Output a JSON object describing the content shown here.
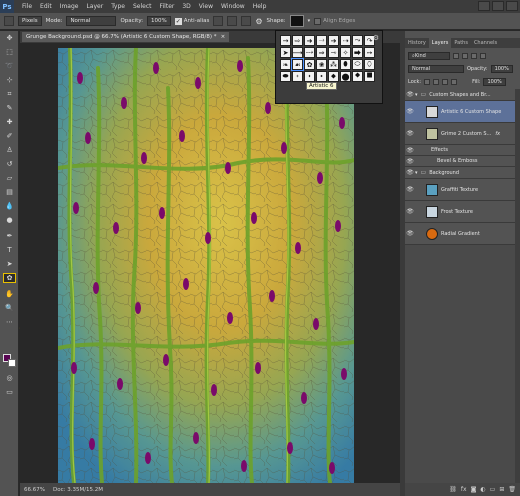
{
  "menubar": {
    "logo": "Ps",
    "items": [
      "File",
      "Edit",
      "Image",
      "Layer",
      "Type",
      "Select",
      "Filter",
      "3D",
      "View",
      "Window",
      "Help"
    ]
  },
  "options": {
    "mode_type": "Pixels",
    "mode_label": "Mode:",
    "mode_value": "Normal",
    "opacity_label": "Opacity:",
    "opacity_value": "100%",
    "antialias_label": "Anti-alias",
    "shape_label": "Shape:",
    "align_label": "Align Edges"
  },
  "document": {
    "tab_title": "Grunge Background.psd @ 66.7% (Artistic 6 Custom Shape, RGB/8) *",
    "zoom": "66.67%",
    "doc_size": "Doc: 3.35M/15.2M"
  },
  "color": {
    "foreground": "#580452",
    "background": "#ffffff",
    "code": "#580452"
  },
  "shape_picker": {
    "tooltip": "Artistic 6",
    "shapes": [
      "→",
      "⇨",
      "➜",
      "⤑",
      "➔",
      "⇢",
      "⤳",
      "↷",
      "➤",
      "⟶",
      "⤏",
      "⇒",
      "⇾",
      "✧",
      "⮕",
      "➙",
      "❧",
      "☙",
      "✿",
      "❀",
      "⁂",
      "⬮",
      "⬭",
      "⬯",
      "⬬",
      "⬫",
      "⬪",
      "⬩",
      "⬥",
      "⬤",
      "⯁",
      "⯀"
    ]
  },
  "panel": {
    "tabs": [
      "History",
      "Layers",
      "Paths",
      "Channels"
    ],
    "active_tab": "Layers",
    "kind_label": "Kind",
    "blend_mode": "Normal",
    "opacity_label": "Opacity:",
    "opacity_value": "100%",
    "lock_label": "Lock:",
    "fill_label": "Fill:",
    "fill_value": "100%",
    "layers": [
      {
        "name": "Custom Shapes and Br...",
        "kind": "group",
        "color": "#6a6a6a",
        "selected": false,
        "indent": 0
      },
      {
        "name": "Artistic 6 Custom Shape",
        "kind": "layer",
        "color": "#d8d8d8",
        "selected": true,
        "indent": 1
      },
      {
        "name": "Grime 2 Custom S...",
        "kind": "layer",
        "color": "#bfc2a0",
        "selected": false,
        "indent": 1,
        "fx": "fx"
      },
      {
        "name": "Effects",
        "kind": "effects",
        "selected": false,
        "indent": 2
      },
      {
        "name": "Bevel & Emboss",
        "kind": "effect",
        "selected": false,
        "indent": 3
      },
      {
        "name": "Background",
        "kind": "group",
        "color": "#6a6a6a",
        "selected": false,
        "indent": 0
      },
      {
        "name": "Graffiti Texture",
        "kind": "layer",
        "color": "#5aa0c0",
        "selected": false,
        "indent": 1
      },
      {
        "name": "Frost Texture",
        "kind": "layer",
        "color": "#c9d6e0",
        "selected": false,
        "indent": 1
      },
      {
        "name": "Radial Gradient",
        "kind": "layer",
        "color": "#d96a10",
        "selected": false,
        "indent": 1
      }
    ],
    "footer_icons": [
      "link-icon",
      "fx-icon",
      "mask-icon",
      "adjustment-icon",
      "folder-icon",
      "new-layer-icon",
      "trash-icon"
    ]
  }
}
